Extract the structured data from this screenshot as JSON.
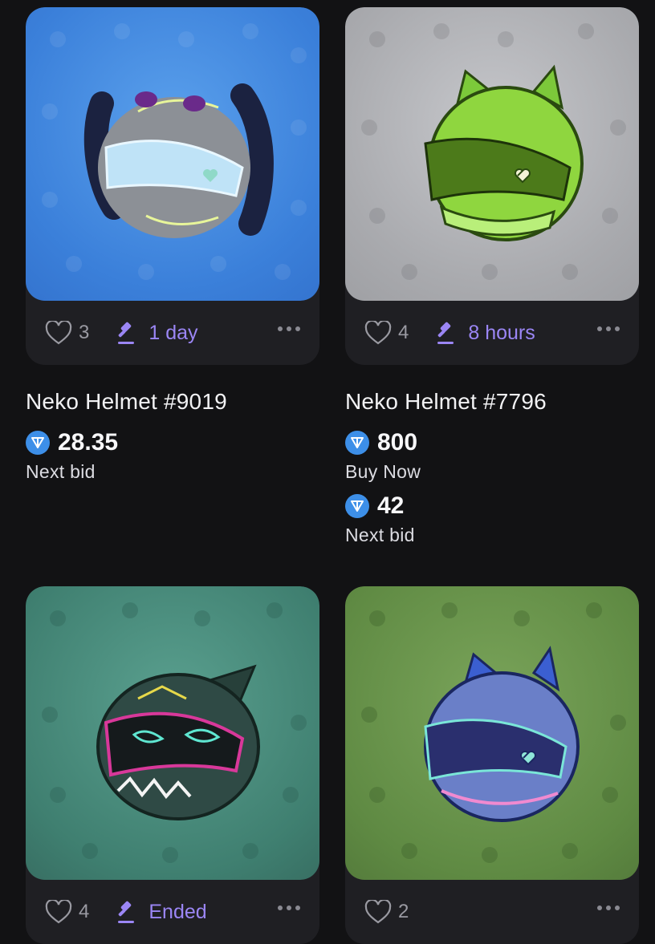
{
  "currency_icon": "ton-diamond-icon",
  "colors": {
    "accent": "#9b86f5",
    "ton_blue": "#3d8fe8",
    "page_bg": "#121214",
    "card_bg": "#1f1f23"
  },
  "cards": [
    {
      "likes": "3",
      "time": "1 day",
      "title": "Neko Helmet #9019",
      "price1": "28.35",
      "label1": "Next bid"
    },
    {
      "likes": "4",
      "time": "8 hours",
      "title": "Neko Helmet #7796",
      "price1": "800",
      "label1": "Buy Now",
      "price2": "42",
      "label2": "Next bid"
    },
    {
      "likes": "4",
      "time": "Ended"
    },
    {
      "likes": "2"
    }
  ]
}
